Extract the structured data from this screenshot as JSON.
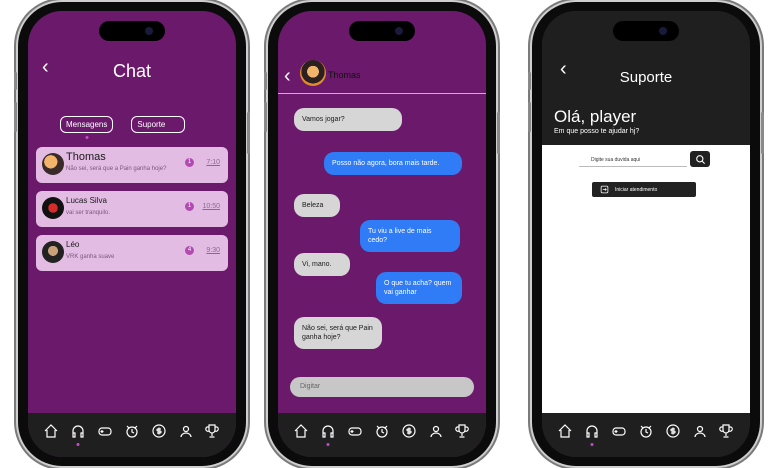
{
  "chat_list": {
    "title": "Chat",
    "tabs": [
      "Mensagens",
      "Suporte"
    ],
    "conversations": [
      {
        "name": "Thomas",
        "preview": "Não sei, será que a Pain ganha hoje?",
        "unread": "1",
        "time": "7:10"
      },
      {
        "name": "Lucas Silva",
        "preview": "vai ser tranquilo.",
        "unread": "1",
        "time": "10:50"
      },
      {
        "name": "Léo",
        "preview": "VRK ganha suave",
        "unread": "4",
        "time": "9:30"
      }
    ]
  },
  "conversation": {
    "contact": "Thomas",
    "messages": [
      {
        "from": "in",
        "text": "Vamos jogar?"
      },
      {
        "from": "out",
        "text": "Posso não agora, bora mais tarde."
      },
      {
        "from": "in",
        "text": "Beleza"
      },
      {
        "from": "out",
        "text": "Tu viu a live de mais cedo?"
      },
      {
        "from": "in",
        "text": "Vi, mano."
      },
      {
        "from": "out",
        "text": "O que tu acha? quem vai ganhar"
      },
      {
        "from": "in",
        "text": "Não sei, será que Pain ganha hoje?"
      }
    ],
    "input_placeholder": "Digitar"
  },
  "support": {
    "title": "Suporte",
    "greeting": "Olá, player",
    "subtitle": "Em que posso te ajudar hj?",
    "search_placeholder": "Digite sua duvida aqui",
    "start_button": "Iniciar atendimento"
  },
  "nav_icons": [
    "home-icon",
    "headset-icon",
    "gamepad-icon",
    "alarm-icon",
    "coin-icon",
    "user-icon",
    "trophy-icon"
  ],
  "colors": {
    "purple": "#6b1a6b",
    "bubble_out": "#2f7cf6",
    "bubble_in": "#d6d6d6",
    "card": "#e3bce3",
    "badge": "#b24ab2"
  }
}
